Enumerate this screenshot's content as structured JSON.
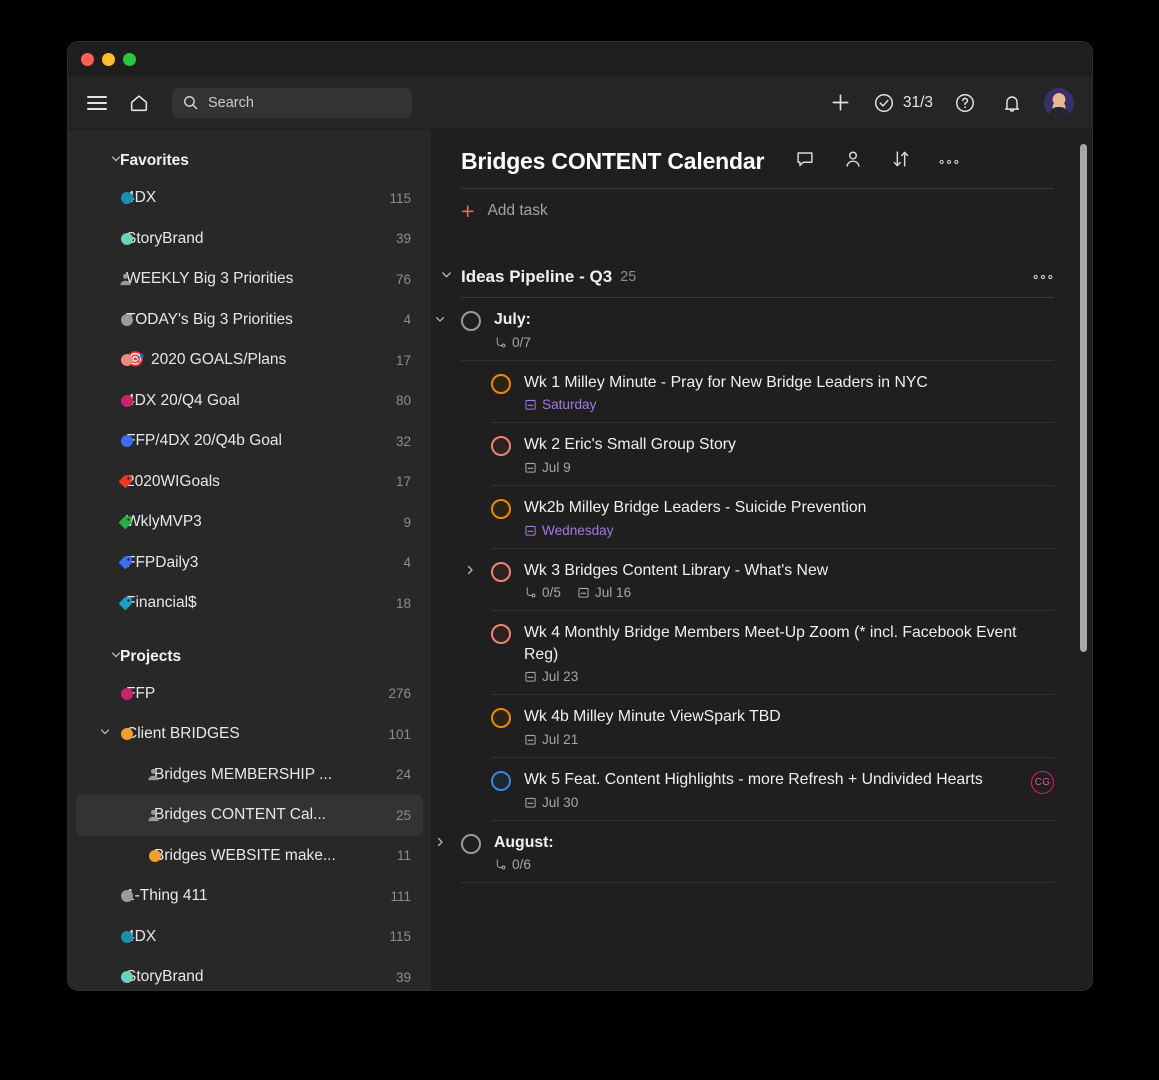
{
  "window": {
    "traffic_lights": [
      "close",
      "minimize",
      "maximize"
    ]
  },
  "toolbar": {
    "menu_icon": "hamburger-icon",
    "home_icon": "home-icon",
    "search": {
      "placeholder": "Search",
      "value": ""
    },
    "add_label": "+",
    "karma_count": "31/3",
    "help_label": "?",
    "notifications_icon": "bell-icon",
    "avatar_label": ""
  },
  "sidebar": {
    "favorites": {
      "label": "Favorites",
      "items": [
        {
          "label": "4DX",
          "count": "115",
          "icon": "dot",
          "color": "#1f8db0"
        },
        {
          "label": "StoryBrand",
          "count": "39",
          "icon": "dot",
          "color": "#6ccfc0"
        },
        {
          "label": "WEEKLY Big 3 Priorities",
          "count": "76",
          "icon": "person",
          "color": "#9a9a9a"
        },
        {
          "label": "TODAY's Big 3 Priorities",
          "count": "4",
          "icon": "dot",
          "color": "#9a9a9a"
        },
        {
          "label": "2020 GOALS/Plans",
          "count": "17",
          "icon": "dot",
          "color": "#ef8a82",
          "emoji": "🎯"
        },
        {
          "label": "4DX 20/Q4 Goal",
          "count": "80",
          "icon": "dot",
          "color": "#c8246c"
        },
        {
          "label": "FFP/4DX 20/Q4b Goal",
          "count": "32",
          "icon": "dot",
          "color": "#3b6ff0"
        },
        {
          "label": "2020WIGoals",
          "count": "17",
          "icon": "tag",
          "color": "#eb3a22"
        },
        {
          "label": "WklyMVP3",
          "count": "9",
          "icon": "tag",
          "color": "#2aab4c"
        },
        {
          "label": "FFPDaily3",
          "count": "4",
          "icon": "tag",
          "color": "#3b6ff0"
        },
        {
          "label": "Financial$",
          "count": "18",
          "icon": "tag",
          "color": "#1f9ec4"
        }
      ]
    },
    "projects": {
      "label": "Projects",
      "items": [
        {
          "label": "FFP",
          "count": "276",
          "icon": "dot",
          "color": "#c8246c",
          "level": 1,
          "selected": false,
          "expandable": false
        },
        {
          "label": "Client BRIDGES",
          "count": "101",
          "icon": "dot",
          "color": "#f0a030",
          "level": 1,
          "selected": false,
          "expandable": true,
          "expanded": true
        },
        {
          "label": "Bridges MEMBERSHIP ...",
          "count": "24",
          "icon": "person",
          "color": "#9a9a9a",
          "level": 2,
          "selected": false,
          "expandable": false
        },
        {
          "label": "Bridges CONTENT Cal...",
          "count": "25",
          "icon": "person",
          "color": "#9a9a9a",
          "level": 2,
          "selected": true,
          "expandable": false
        },
        {
          "label": "Bridges WEBSITE make...",
          "count": "11",
          "icon": "dot",
          "color": "#f0a030",
          "level": 2,
          "selected": false,
          "expandable": false
        },
        {
          "label": "1-Thing 411",
          "count": "111",
          "icon": "dot",
          "color": "#9a9a9a",
          "level": 1,
          "selected": false,
          "expandable": false
        },
        {
          "label": "4DX",
          "count": "115",
          "icon": "dot",
          "color": "#1f8db0",
          "level": 1,
          "selected": false,
          "expandable": false
        },
        {
          "label": "StoryBrand",
          "count": "39",
          "icon": "dot",
          "color": "#6ccfc0",
          "level": 1,
          "selected": false,
          "expandable": false
        }
      ]
    }
  },
  "main": {
    "title": "Bridges CONTENT Calendar",
    "actions": [
      "comments-icon",
      "person-icon",
      "sort-icon",
      "more-icon"
    ],
    "add_task_label": "Add task",
    "section": {
      "title": "Ideas Pipeline - Q3",
      "count": "25",
      "more_icon": "more-icon"
    },
    "tasks": [
      {
        "name": "July:",
        "bold": true,
        "level": 1,
        "checkbox": "plain",
        "expandable": true,
        "expanded": true,
        "meta": [
          {
            "icon": "subtask-icon",
            "text": "0/7",
            "style": "normal"
          }
        ],
        "badge": ""
      },
      {
        "name": "Wk 1 Milley Minute - Pray for New Bridge Leaders in NYC",
        "bold": false,
        "level": 2,
        "checkbox": "orange",
        "expandable": false,
        "meta": [
          {
            "icon": "calendar-icon",
            "text": "Saturday",
            "style": "purple"
          }
        ],
        "badge": ""
      },
      {
        "name": "Wk 2 Eric's Small Group Story",
        "bold": false,
        "level": 2,
        "checkbox": "salmon",
        "expandable": false,
        "meta": [
          {
            "icon": "calendar-icon",
            "text": "Jul 9",
            "style": "normal"
          }
        ],
        "badge": ""
      },
      {
        "name": "Wk2b Milley Bridge Leaders - Suicide Prevention",
        "bold": false,
        "level": 2,
        "checkbox": "orange",
        "expandable": false,
        "meta": [
          {
            "icon": "calendar-icon",
            "text": "Wednesday",
            "style": "purple"
          }
        ],
        "badge": ""
      },
      {
        "name": "Wk 3 Bridges Content Library - What's New",
        "bold": false,
        "level": 2,
        "checkbox": "salmon",
        "expandable": true,
        "expanded": false,
        "meta": [
          {
            "icon": "subtask-icon",
            "text": "0/5",
            "style": "normal"
          },
          {
            "icon": "calendar-icon",
            "text": "Jul 16",
            "style": "normal"
          }
        ],
        "badge": ""
      },
      {
        "name": "Wk 4 Monthly Bridge Members Meet-Up Zoom (* incl. Facebook Event Reg)",
        "bold": false,
        "level": 2,
        "checkbox": "salmon",
        "expandable": false,
        "meta": [
          {
            "icon": "calendar-icon",
            "text": "Jul 23",
            "style": "normal"
          }
        ],
        "badge": ""
      },
      {
        "name": "Wk 4b Milley Minute ViewSpark TBD",
        "bold": false,
        "level": 2,
        "checkbox": "orange",
        "expandable": false,
        "meta": [
          {
            "icon": "calendar-icon",
            "text": "Jul 21",
            "style": "normal"
          }
        ],
        "badge": ""
      },
      {
        "name": "Wk 5 Feat. Content Highlights - more Refresh + Undivided Hearts",
        "bold": false,
        "level": 2,
        "checkbox": "blue",
        "expandable": false,
        "meta": [
          {
            "icon": "calendar-icon",
            "text": "Jul 30",
            "style": "normal"
          }
        ],
        "badge": "CG"
      },
      {
        "name": "August:",
        "bold": true,
        "level": 1,
        "checkbox": "plain",
        "expandable": true,
        "expanded": false,
        "meta": [
          {
            "icon": "subtask-icon",
            "text": "0/6",
            "style": "normal"
          }
        ],
        "badge": ""
      }
    ]
  },
  "colors": {
    "accent_red": "#e8685d",
    "sidebar_bg": "#282828",
    "main_bg": "#1f1f1f",
    "selected_row": "#333333",
    "purple_date": "#a479e0"
  }
}
